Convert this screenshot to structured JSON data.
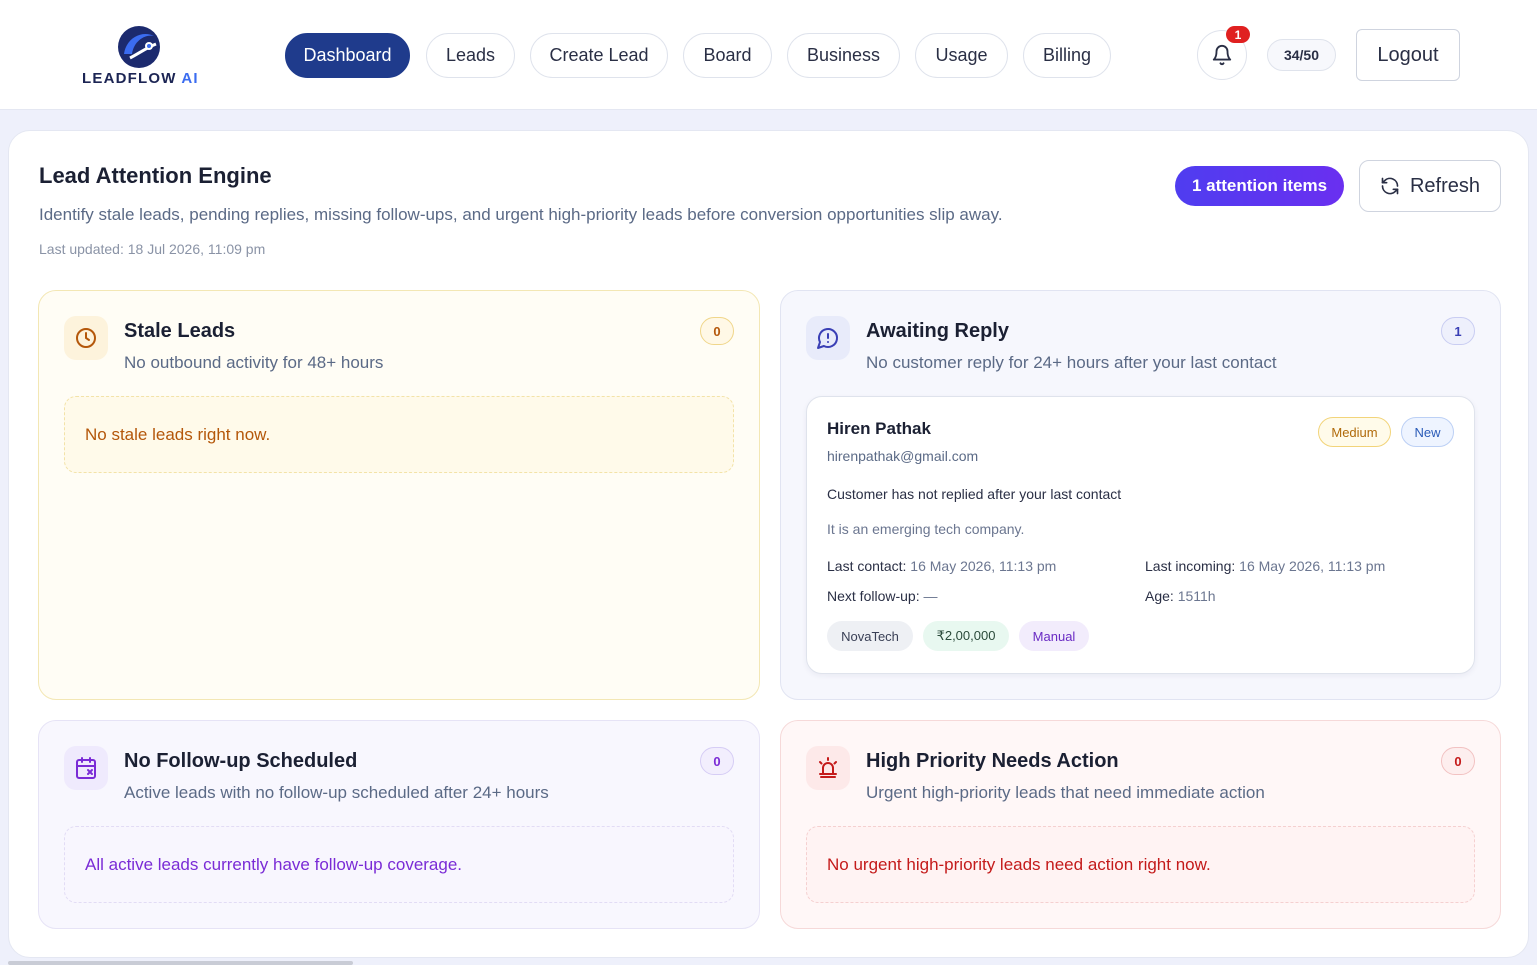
{
  "brand": {
    "name_main": "LEADFLOW",
    "name_accent": " AI"
  },
  "nav": [
    {
      "label": "Dashboard",
      "active": true
    },
    {
      "label": "Leads"
    },
    {
      "label": "Create Lead"
    },
    {
      "label": "Board"
    },
    {
      "label": "Business"
    },
    {
      "label": "Usage"
    },
    {
      "label": "Billing"
    }
  ],
  "header": {
    "notification_count": "1",
    "usage": "34/50",
    "logout_label": "Logout"
  },
  "page": {
    "title": "Lead Attention Engine",
    "subtitle": "Identify stale leads, pending replies, missing follow-ups, and urgent high-priority leads before conversion opportunities slip away.",
    "last_updated": "Last updated: 18 Jul 2026, 11:09 pm",
    "attention_label": "1 attention items",
    "refresh_label": "Refresh"
  },
  "panels": {
    "stale": {
      "title": "Stale Leads",
      "desc": "No outbound activity for 48+ hours",
      "count": "0",
      "empty": "No stale leads right now."
    },
    "awaiting": {
      "title": "Awaiting Reply",
      "desc": "No customer reply for 24+ hours after your last contact",
      "count": "1"
    },
    "nofollow": {
      "title": "No Follow-up Scheduled",
      "desc": "Active leads with no follow-up scheduled after 24+ hours",
      "count": "0",
      "empty": "All active leads currently have follow-up coverage."
    },
    "high": {
      "title": "High Priority Needs Action",
      "desc": "Urgent high-priority leads that need immediate action",
      "count": "0",
      "empty": "No urgent high-priority leads need action right now."
    }
  },
  "lead": {
    "name": "Hiren Pathak",
    "email": "hirenpathak@gmail.com",
    "priority": "Medium",
    "status": "New",
    "reason": "Customer has not replied after your last contact",
    "note": "It is an emerging tech company.",
    "last_contact_label": "Last contact:",
    "last_contact": "16 May 2026, 11:13 pm",
    "last_incoming_label": "Last incoming:",
    "last_incoming": "16 May 2026, 11:13 pm",
    "next_followup_label": "Next follow-up:",
    "next_followup": "—",
    "age_label": "Age:",
    "age": "1511h",
    "tags": [
      "NovaTech",
      "₹2,00,000",
      "Manual"
    ]
  },
  "colors": {
    "primary": "#1f3b8c",
    "accent_purple": "#5b35f0",
    "stale": "#b4570a",
    "awaiting": "#3a3fb5",
    "nofollow": "#7a2bd6",
    "high": "#c41a1a"
  }
}
